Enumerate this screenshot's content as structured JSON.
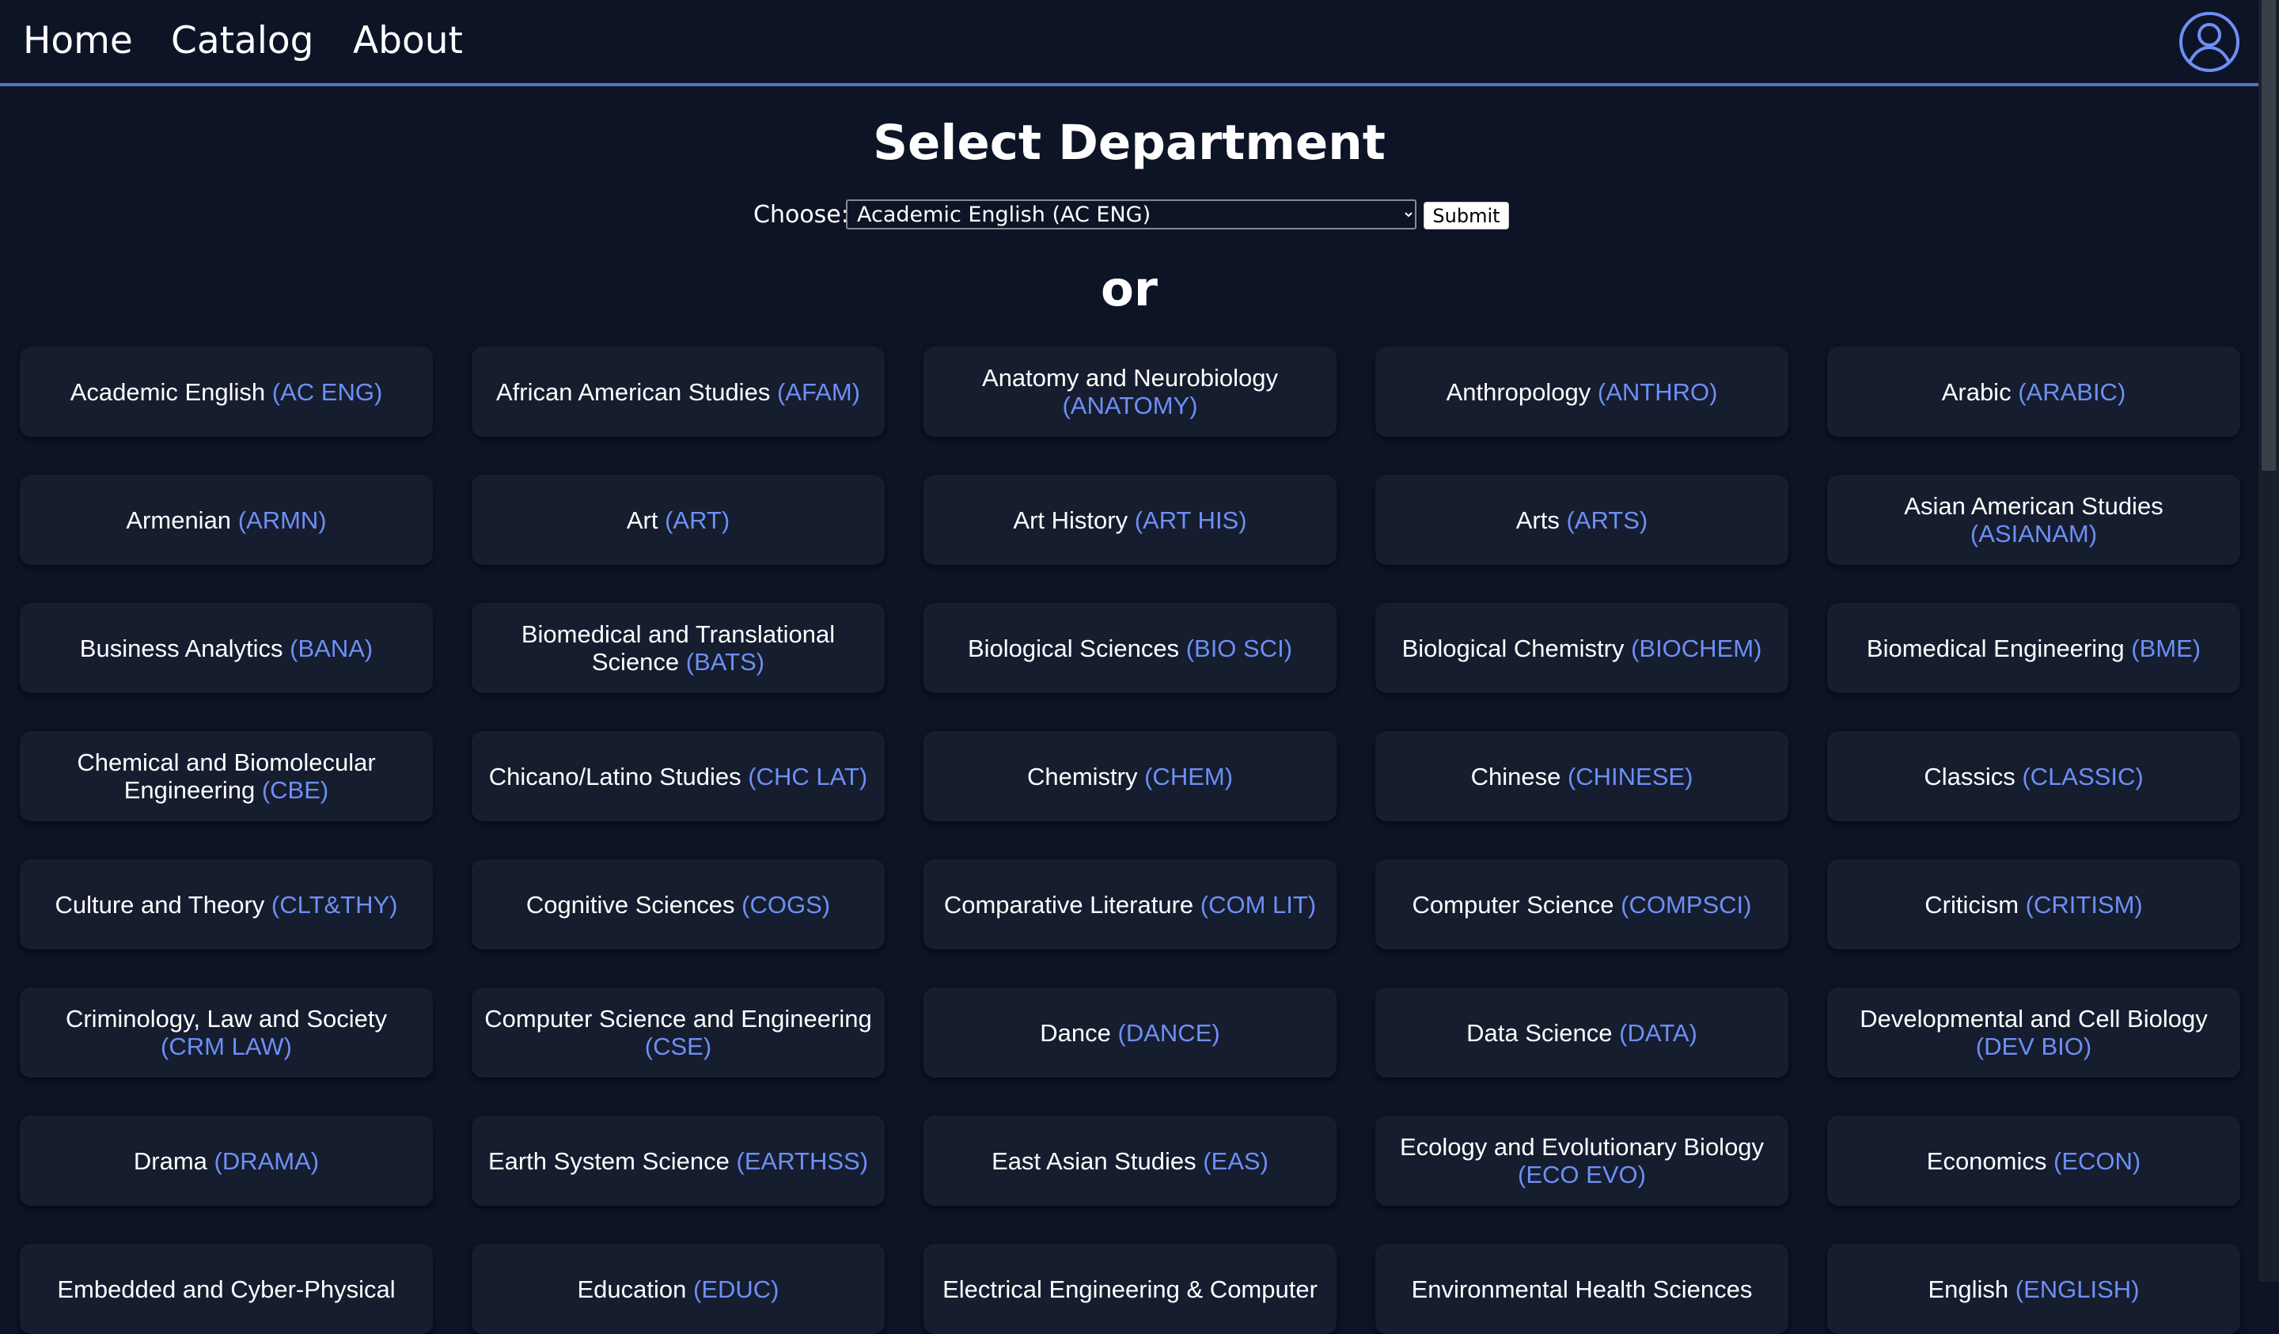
{
  "nav": {
    "home": "Home",
    "catalog": "Catalog",
    "about": "About"
  },
  "page": {
    "title": "Select Department",
    "choose_label": "Choose:",
    "selected_option": "Academic English (AC ENG)",
    "submit_label": "Submit",
    "or_text": "or"
  },
  "colors": {
    "background": "#0c1426",
    "card": "#151d2f",
    "accent": "#6e8ff5",
    "nav_border": "#5470c6"
  },
  "departments": [
    {
      "name": "Academic English",
      "code": "(AC ENG)"
    },
    {
      "name": "African American Studies",
      "code": "(AFAM)"
    },
    {
      "name": "Anatomy and Neurobiology",
      "code": "(ANATOMY)"
    },
    {
      "name": "Anthropology",
      "code": "(ANTHRO)"
    },
    {
      "name": "Arabic",
      "code": "(ARABIC)"
    },
    {
      "name": "Armenian",
      "code": "(ARMN)"
    },
    {
      "name": "Art",
      "code": "(ART)"
    },
    {
      "name": "Art History",
      "code": "(ART HIS)"
    },
    {
      "name": "Arts",
      "code": "(ARTS)"
    },
    {
      "name": "Asian American Studies",
      "code": "(ASIANAM)"
    },
    {
      "name": "Business Analytics",
      "code": "(BANA)"
    },
    {
      "name": "Biomedical and Translational Science",
      "code": "(BATS)"
    },
    {
      "name": "Biological Sciences",
      "code": "(BIO SCI)"
    },
    {
      "name": "Biological Chemistry",
      "code": "(BIOCHEM)"
    },
    {
      "name": "Biomedical Engineering",
      "code": "(BME)"
    },
    {
      "name": "Chemical and Biomolecular Engineering",
      "code": "(CBE)"
    },
    {
      "name": "Chicano/Latino Studies",
      "code": "(CHC LAT)"
    },
    {
      "name": "Chemistry",
      "code": "(CHEM)"
    },
    {
      "name": "Chinese",
      "code": "(CHINESE)"
    },
    {
      "name": "Classics",
      "code": "(CLASSIC)"
    },
    {
      "name": "Culture and Theory",
      "code": "(CLT&THY)"
    },
    {
      "name": "Cognitive Sciences",
      "code": "(COGS)"
    },
    {
      "name": "Comparative Literature",
      "code": "(COM LIT)"
    },
    {
      "name": "Computer Science",
      "code": "(COMPSCI)"
    },
    {
      "name": "Criticism",
      "code": "(CRITISM)"
    },
    {
      "name": "Criminology, Law and Society",
      "code": "(CRM LAW)"
    },
    {
      "name": "Computer Science and Engineering",
      "code": "(CSE)"
    },
    {
      "name": "Dance",
      "code": "(DANCE)"
    },
    {
      "name": "Data Science",
      "code": "(DATA)"
    },
    {
      "name": "Developmental and Cell Biology",
      "code": "(DEV BIO)"
    },
    {
      "name": "Drama",
      "code": "(DRAMA)"
    },
    {
      "name": "Earth System Science",
      "code": "(EARTHSS)"
    },
    {
      "name": "East Asian Studies",
      "code": "(EAS)"
    },
    {
      "name": "Ecology and Evolutionary Biology",
      "code": "(ECO EVO)"
    },
    {
      "name": "Economics",
      "code": "(ECON)"
    },
    {
      "name": "Embedded and Cyber-Physical",
      "code": ""
    },
    {
      "name": "Education",
      "code": "(EDUC)"
    },
    {
      "name": "Electrical Engineering & Computer",
      "code": ""
    },
    {
      "name": "Environmental Health Sciences",
      "code": ""
    },
    {
      "name": "English",
      "code": "(ENGLISH)"
    }
  ]
}
